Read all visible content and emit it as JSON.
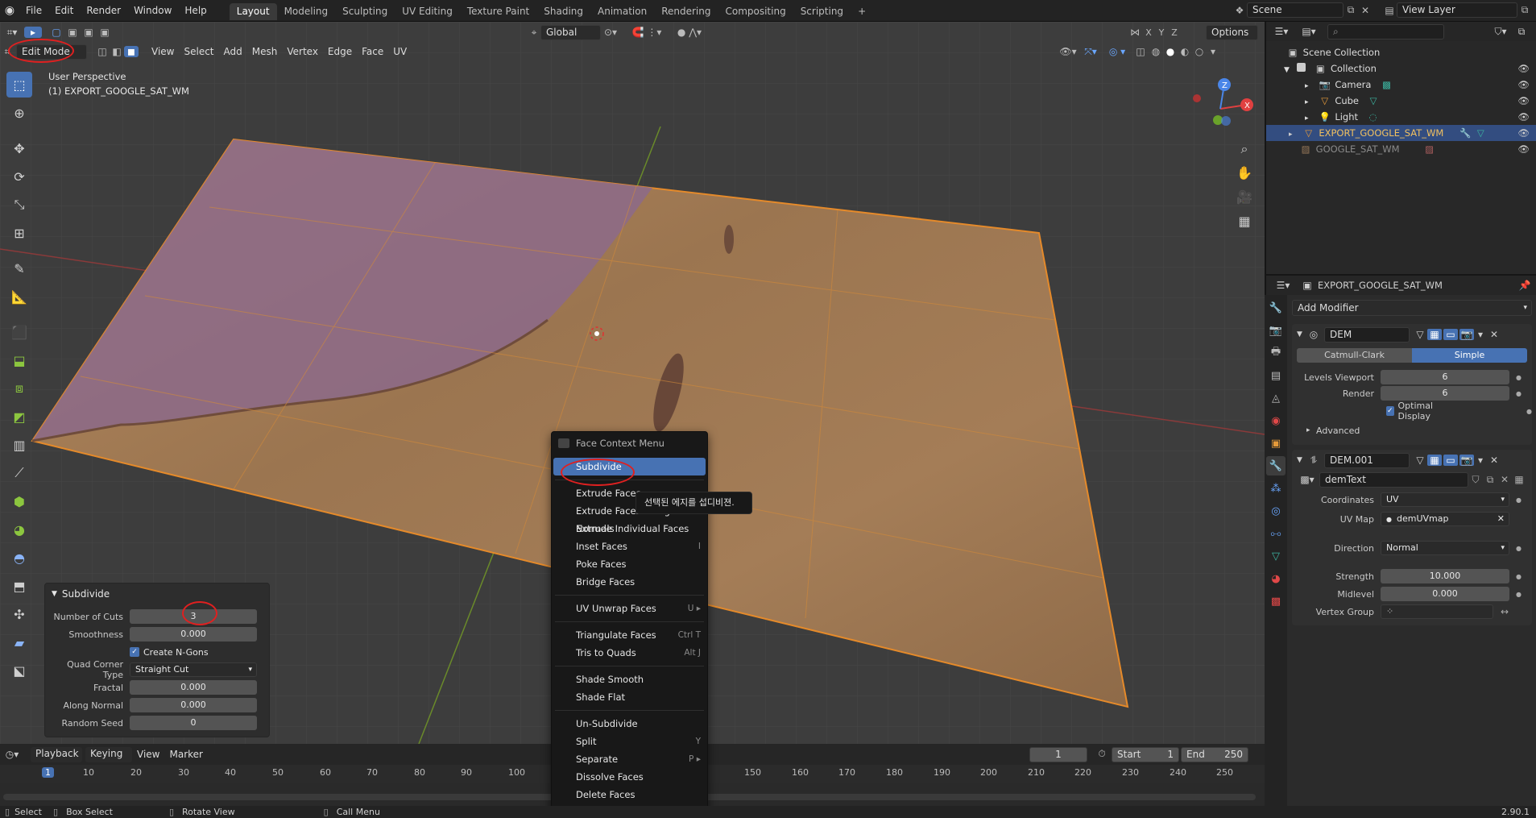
{
  "topbar": {
    "menus": [
      "File",
      "Edit",
      "Render",
      "Window",
      "Help"
    ],
    "workspaces": [
      "Layout",
      "Modeling",
      "Sculpting",
      "UV Editing",
      "Texture Paint",
      "Shading",
      "Animation",
      "Rendering",
      "Compositing",
      "Scripting"
    ],
    "active_workspace": "Layout",
    "add_tab": "+",
    "scene": "Scene",
    "view_layer": "View Layer"
  },
  "viewport": {
    "mode": "Edit Mode",
    "menus": [
      "View",
      "Select",
      "Add",
      "Mesh",
      "Vertex",
      "Edge",
      "Face",
      "UV"
    ],
    "transform_orientation": "Global",
    "options": "Options",
    "axis_x": "X",
    "axis_y": "Y",
    "axis_z": "Z",
    "perspective_label": "User Perspective",
    "object_label": "(1) EXPORT_GOOGLE_SAT_WM"
  },
  "operator_panel": {
    "title": "Subdivide",
    "number_of_cuts_label": "Number of Cuts",
    "number_of_cuts": "3",
    "smoothness_label": "Smoothness",
    "smoothness": "0.000",
    "create_ngons_label": "Create N-Gons",
    "create_ngons": true,
    "quad_corner_label": "Quad Corner Type",
    "quad_corner_value": "Straight Cut",
    "fractal_label": "Fractal",
    "fractal": "0.000",
    "along_normal_label": "Along Normal",
    "along_normal": "0.000",
    "random_seed_label": "Random Seed",
    "random_seed": "0"
  },
  "context_menu": {
    "title": "Face Context Menu",
    "items": [
      {
        "label": "Subdivide",
        "shortcut": ""
      },
      {
        "label": "Extrude Faces",
        "shortcut": ""
      },
      {
        "label": "Extrude Faces Along Normals",
        "shortcut": ""
      },
      {
        "label": "Extrude Individual Faces",
        "shortcut": ""
      },
      {
        "label": "Inset Faces",
        "shortcut": "I"
      },
      {
        "label": "Poke Faces",
        "shortcut": ""
      },
      {
        "label": "Bridge Faces",
        "shortcut": ""
      },
      {
        "label": "UV Unwrap Faces",
        "shortcut": "U ▸"
      },
      {
        "label": "Triangulate Faces",
        "shortcut": "Ctrl T"
      },
      {
        "label": "Tris to Quads",
        "shortcut": "Alt J"
      },
      {
        "label": "Shade Smooth",
        "shortcut": ""
      },
      {
        "label": "Shade Flat",
        "shortcut": ""
      },
      {
        "label": "Un-Subdivide",
        "shortcut": ""
      },
      {
        "label": "Split",
        "shortcut": "Y"
      },
      {
        "label": "Separate",
        "shortcut": "P ▸"
      },
      {
        "label": "Dissolve Faces",
        "shortcut": ""
      },
      {
        "label": "Delete Faces",
        "shortcut": ""
      }
    ],
    "tooltip": "선택된 에지를 섭디비젼."
  },
  "timeline": {
    "menus": [
      "Playback",
      "Keying",
      "View",
      "Marker"
    ],
    "current_frame": "1",
    "start_label": "Start",
    "start": "1",
    "end_label": "End",
    "end": "250",
    "ruler": [
      "1",
      "10",
      "20",
      "30",
      "40",
      "50",
      "60",
      "70",
      "80",
      "90",
      "100",
      "150",
      "160",
      "170",
      "180",
      "190",
      "200",
      "210",
      "220",
      "230",
      "240",
      "250"
    ]
  },
  "statusbar": {
    "select": "Select",
    "box_select": "Box Select",
    "rotate_view": "Rotate View",
    "call_menu": "Call Menu",
    "version": "2.90.1"
  },
  "outliner": {
    "scene_collection": "Scene Collection",
    "items": [
      {
        "label": "Collection",
        "level": 1
      },
      {
        "label": "Camera",
        "level": 2
      },
      {
        "label": "Cube",
        "level": 2
      },
      {
        "label": "Light",
        "level": 2
      },
      {
        "label": "EXPORT_GOOGLE_SAT_WM",
        "level": 1,
        "selected": true
      },
      {
        "label": "GOOGLE_SAT_WM",
        "level": 1,
        "dim": true
      }
    ]
  },
  "properties": {
    "object_name": "EXPORT_GOOGLE_SAT_WM",
    "add_modifier": "Add Modifier",
    "mod1_name": "DEM",
    "catmull": "Catmull-Clark",
    "simple": "Simple",
    "levels_viewport_label": "Levels Viewport",
    "levels_viewport": "6",
    "render_label": "Render",
    "render": "6",
    "optimal_display": "Optimal Display",
    "advanced": "Advanced",
    "mod2_name": "DEM.001",
    "texture": "demText",
    "coordinates_label": "Coordinates",
    "coordinates": "UV",
    "uvmap_label": "UV Map",
    "uvmap": "demUVmap",
    "direction_label": "Direction",
    "direction": "Normal",
    "strength_label": "Strength",
    "strength": "10.000",
    "midlevel_label": "Midlevel",
    "midlevel": "0.000",
    "vertex_group_label": "Vertex Group"
  }
}
